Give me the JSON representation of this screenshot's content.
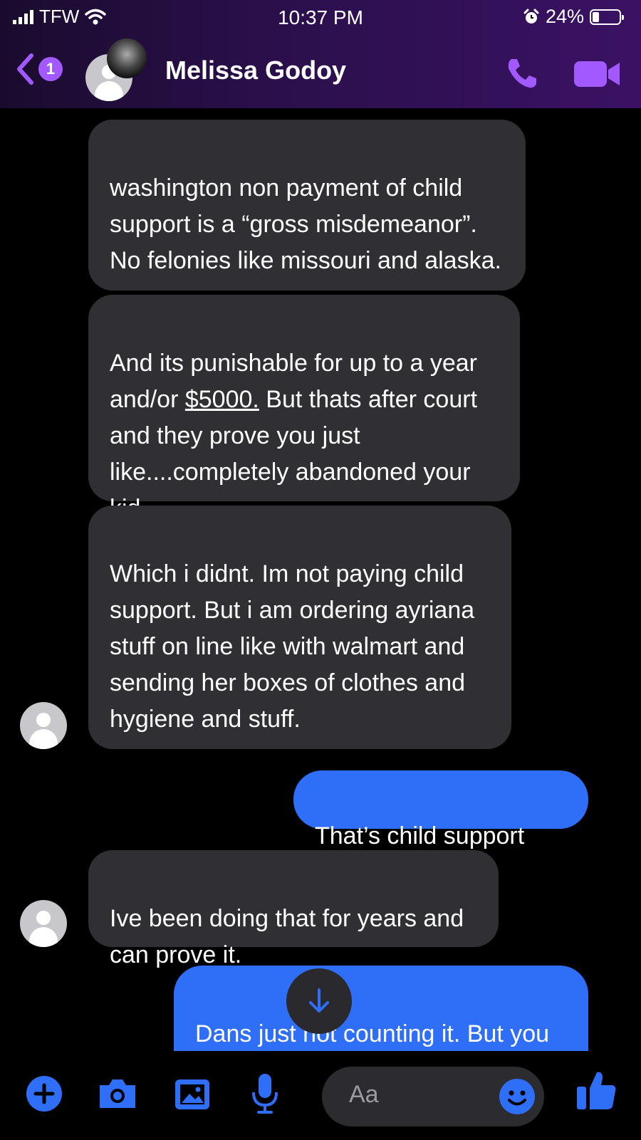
{
  "status_bar": {
    "carrier": "TFW",
    "time": "10:37 PM",
    "battery": "24%"
  },
  "header": {
    "unread_count": "1",
    "contact_name": "Melissa Godoy"
  },
  "messages": [
    {
      "direction": "incoming",
      "text": "washington non payment of child support is a “gross misdemeanor”. No felonies like missouri and alaska."
    },
    {
      "direction": "incoming",
      "text_before": "And its punishable for up to a year and/or ",
      "text_link": "$5000.",
      "text_after": " But thats after court and they prove you just like....completely abandoned your kid."
    },
    {
      "direction": "incoming",
      "text": "Which i didnt. Im not paying child support. But i am ordering ayriana stuff on line like with walmart and sending her boxes of clothes and hygiene and stuff."
    },
    {
      "direction": "outgoing",
      "text": "That’s child support"
    },
    {
      "direction": "incoming",
      "text": "Ive been doing that for years and can prove it."
    },
    {
      "direction": "outgoing",
      "text": "Dans just not counting it. But you have proof"
    }
  ],
  "composer": {
    "placeholder": "Aa"
  },
  "colors": {
    "accent": "#a259ff",
    "outgoing_bubble": "#2f6ef7",
    "incoming_bubble": "#303034"
  },
  "icons": [
    "back-chevron-icon",
    "phone-icon",
    "video-camera-icon",
    "plus-icon",
    "camera-icon",
    "image-icon",
    "microphone-icon",
    "emoji-icon",
    "thumbs-up-icon",
    "arrow-down-icon"
  ]
}
